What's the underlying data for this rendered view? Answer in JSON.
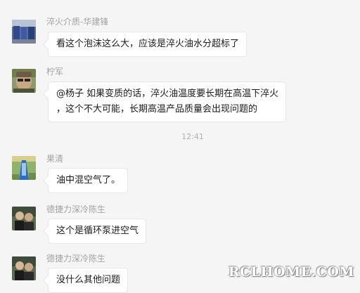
{
  "messages": [
    {
      "sender": "淬火介质-华建锋",
      "lines": [
        "看这个泡沫这么大，应该是淬火油水分超标了"
      ],
      "avatar_icon": "avatar-blue-machine-icon"
    },
    {
      "sender": "柠军",
      "lines": [
        "@杨子 如果变质的话，淬火油温度要长期在高温下淬火",
        "，这个不大可能，长期高温产品质量会出现问题的"
      ],
      "avatar_icon": "avatar-person-sunglasses-icon"
    },
    {
      "sender": "果清",
      "lines": [
        "油中混空气了。"
      ],
      "avatar_icon": "avatar-machine-blue-icon"
    },
    {
      "sender": "德捷力深冷陈生",
      "lines": [
        "这个是循环泵进空气"
      ],
      "avatar_icon": "avatar-two-people-icon"
    },
    {
      "sender": "德捷力深冷陈生",
      "lines": [
        "没什么其他问题"
      ],
      "avatar_icon": "avatar-two-people-icon"
    }
  ],
  "timestamp": "12:41",
  "watermark": "RCLHOME.COM",
  "colors": {
    "background": "#f5f5f5",
    "bubble": "#ffffff",
    "sender_text": "#a3a3a3",
    "timestamp_text": "#b0b0b0"
  }
}
